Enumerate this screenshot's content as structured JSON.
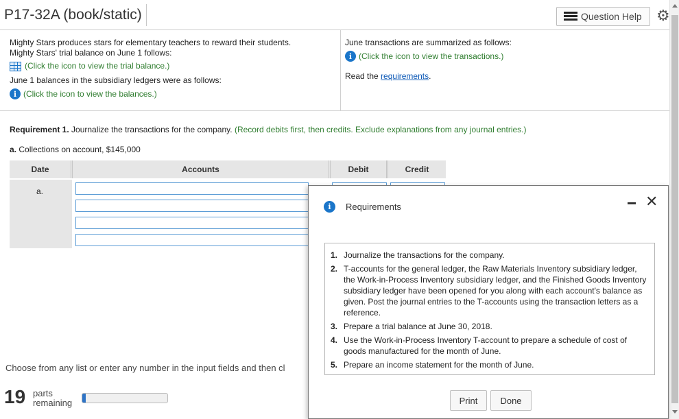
{
  "header": {
    "title": "P17-32A (book/static)",
    "question_help": "Question Help",
    "settings_icon": "gear-icon"
  },
  "info": {
    "intro_line1": "Mighty Stars produces stars for elementary teachers to reward their students.",
    "intro_line2": "Mighty Stars' trial balance on June 1 follows:",
    "trial_balance_link": "(Click the icon to view the trial balance.)",
    "balances_intro": "June 1 balances in the subsidiary ledgers were as follows:",
    "balances_link": "(Click the icon to view the balances.)",
    "transactions_intro": "June transactions are summarized as follows:",
    "transactions_link": "(Click the icon to view the transactions.)",
    "read_the": "Read the",
    "requirements_link": "requirements",
    "period": "."
  },
  "requirement": {
    "label": "Requirement 1.",
    "text": " Journalize the transactions for the company. ",
    "instruction": "(Record debits first, then credits. Exclude explanations from any journal entries.)",
    "sub_label": "a.",
    "sub_text": " Collections on account, $145,000"
  },
  "journal": {
    "columns": [
      "Date",
      "Accounts",
      "Debit",
      "Credit"
    ],
    "row_label": "a."
  },
  "footer": {
    "note": "Choose from any list or enter any number in the input fields and then cl",
    "parts_count": "19",
    "parts_word": "parts",
    "remaining_word": "remaining",
    "progress": 0.04,
    "progress_color": "#2e74c6"
  },
  "modal": {
    "title": "Requirements",
    "items": [
      {
        "num": "1.",
        "text": "Journalize the transactions for the company."
      },
      {
        "num": "2.",
        "text": "T-accounts for the general ledger, the Raw Materials Inventory subsidiary ledger, the Work-in-Process Inventory subsidiary ledger, and the Finished Goods Inventory subsidiary ledger have been opened for you along with each account's balance as given. Post the journal entries to the T-accounts using the transaction letters as a reference."
      },
      {
        "num": "3.",
        "text": "Prepare a trial balance at June 30, 2018."
      },
      {
        "num": "4.",
        "text": "Use the Work-in-Process Inventory T-account to prepare a schedule of cost of goods manufactured for the month of June."
      },
      {
        "num": "5.",
        "text": "Prepare an income statement for the month of June."
      }
    ],
    "print_label": "Print",
    "done_label": "Done",
    "minimize_icon": "minimize-icon",
    "close_icon": "close-icon"
  }
}
